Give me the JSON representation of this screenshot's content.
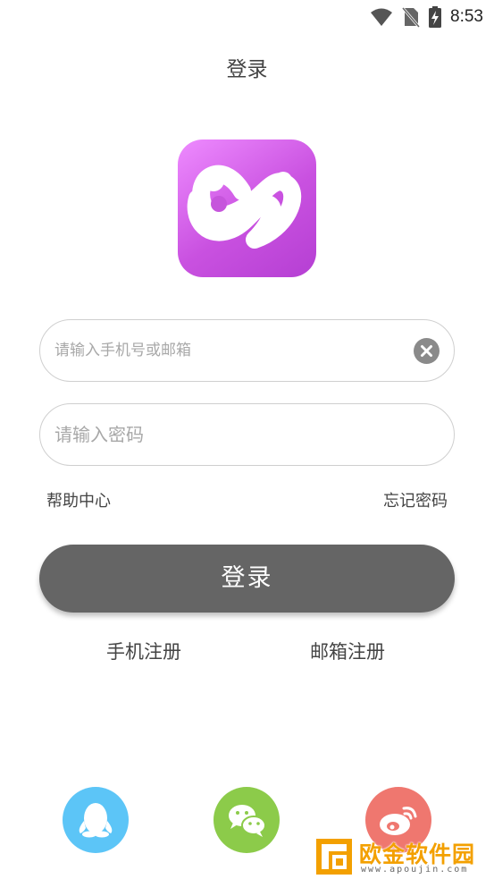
{
  "status_bar": {
    "time": "8:53",
    "icons": [
      "wifi-icon",
      "no-sim-icon",
      "battery-charging-icon"
    ]
  },
  "header": {
    "title": "登录"
  },
  "form": {
    "phone_placeholder": "请输入手机号或邮箱",
    "phone_value": "",
    "password_placeholder": "请输入密码",
    "password_value": "",
    "clear_icon": "clear-icon"
  },
  "links": {
    "help": "帮助中心",
    "forgot_password": "忘记密码"
  },
  "login_button": {
    "label": "登录",
    "color": "#656565"
  },
  "register": {
    "phone": "手机注册",
    "email": "邮箱注册"
  },
  "social_login": [
    {
      "name": "qq",
      "icon": "qq-penguin-icon",
      "color": "#5cc5f7"
    },
    {
      "name": "wechat",
      "icon": "wechat-icon",
      "color": "#8ccb4a"
    },
    {
      "name": "weibo",
      "icon": "weibo-icon",
      "color": "#ef776f"
    }
  ],
  "watermark": {
    "name": "欧金软件园",
    "url": "www.apoujin.com",
    "color": "#f3a000"
  },
  "colors": {
    "logo_gradient_start": "#ee8bff",
    "logo_gradient_end": "#b53fd3"
  }
}
